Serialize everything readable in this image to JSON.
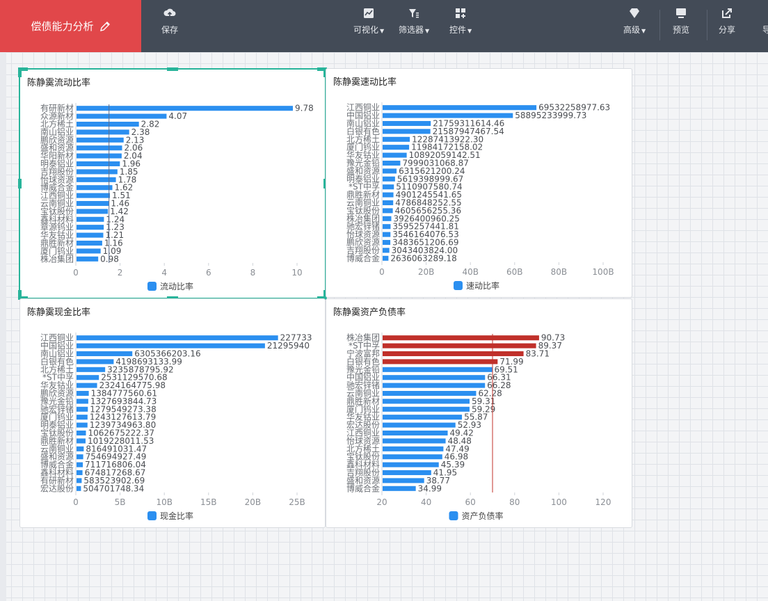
{
  "app": {
    "title": "偿债能力分析"
  },
  "toolbar": {
    "save": "保存",
    "visualize": "可视化",
    "filter": "筛选器",
    "widget": "控件",
    "advanced": "高级",
    "preview": "预览",
    "share": "分享",
    "export": "导"
  },
  "charts": [
    {
      "title": "陈静霙流动比率",
      "legend": "流动比率",
      "color": "#2b8ff0",
      "chart_data": {
        "type": "bar",
        "orientation": "horizontal",
        "categories": [
          "有研新材",
          "众源新材",
          "北方稀土",
          "南山铝业",
          "鹏欣资源",
          "盛和资源",
          "华阳新材",
          "明泰铝业",
          "吉翔股份",
          "怡球资源",
          "博威合金",
          "江西铜业",
          "云南铜业",
          "宝钛股份",
          "鑫科材料",
          "章源钨业",
          "华友钴业",
          "鼎胜新材",
          "厦门钨业",
          "株冶集团"
        ],
        "values": [
          9.78,
          4.07,
          2.82,
          2.38,
          2.13,
          2.06,
          2.04,
          1.96,
          1.85,
          1.78,
          1.62,
          1.51,
          1.46,
          1.42,
          1.24,
          1.23,
          1.21,
          1.16,
          1.09,
          0.98
        ],
        "labels": [
          "9.78",
          "4.07",
          "2.82",
          "2.38",
          "2.13",
          "2.06",
          "2.04",
          "1.96",
          "1.85",
          "1.78",
          "1.62",
          "1.51",
          "1.46",
          "1.42",
          "1.24",
          "1.23",
          "1.21",
          "1.16",
          "1.09",
          "0.98"
        ],
        "xlim": [
          0,
          10
        ],
        "ticks": [
          0,
          2,
          4,
          6,
          8,
          10
        ],
        "tick_labels": [
          "0",
          "2",
          "4",
          "6",
          "8",
          "10"
        ],
        "reference_line": 1.5
      }
    },
    {
      "title": "陈静霙速动比率",
      "legend": "速动比率",
      "color": "#2b8ff0",
      "chart_data": {
        "type": "bar",
        "orientation": "horizontal",
        "categories": [
          "江西铜业",
          "中国铝业",
          "南山铝业",
          "白银有色",
          "北方稀土",
          "厦门钨业",
          "华友钴业",
          "豫光金铅",
          "盛和资源",
          "明泰铝业",
          "*ST中孚",
          "鼎胜新材",
          "云南铜业",
          "宝钛股份",
          "株冶集团",
          "驰宏锌锗",
          "怡球资源",
          "鹏欣资源",
          "吉翔股份",
          "博威合金"
        ],
        "values": [
          69532258977.63,
          58895233999.73,
          21759311614.46,
          21587947467.54,
          12287413922.3,
          11984172158.02,
          10892059142.51,
          7999031068.87,
          6315621200.24,
          5619398999.67,
          5110907580.74,
          4901245541.65,
          4786848252.55,
          4605656255.36,
          3926400960.25,
          3595257441.81,
          3546164076.53,
          3483651206.69,
          3043403824.0,
          2636063289.18
        ],
        "labels": [
          "69532258977.63",
          "58895233999.73",
          "21759311614.46",
          "21587947467.54",
          "12287413922.30",
          "11984172158.02",
          "10892059142.51",
          "7999031068.87",
          "6315621200.24",
          "5619398999.67",
          "5110907580.74",
          "4901245541.65",
          "4786848252.55",
          "4605656255.36",
          "3926400960.25",
          "3595257441.81",
          "3546164076.53",
          "3483651206.69",
          "3043403824.00",
          "2636063289.18"
        ],
        "xlim": [
          0,
          100000000000
        ],
        "ticks": [
          0,
          20000000000,
          40000000000,
          60000000000,
          80000000000,
          100000000000
        ],
        "tick_labels": [
          "0",
          "20B",
          "40B",
          "60B",
          "80B",
          "100B"
        ]
      }
    },
    {
      "title": "陈静霙现金比率",
      "legend": "现金比率",
      "color": "#2b8ff0",
      "chart_data": {
        "type": "bar",
        "orientation": "horizontal",
        "categories": [
          "江西铜业",
          "中国铝业",
          "南山铝业",
          "白银有色",
          "北方稀土",
          "*ST中孚",
          "华友钴业",
          "鹏欣资源",
          "豫光金铅",
          "驰宏锌锗",
          "厦门钨业",
          "明泰铝业",
          "宝钛股份",
          "鼎胜新材",
          "云南铜业",
          "盛和资源",
          "博威合金",
          "鑫科材料",
          "有研新材",
          "宏达股份"
        ],
        "values": [
          22773300000,
          21295940000,
          6305366203.16,
          4198693133.99,
          3235878795.92,
          2531129570.68,
          2324164775.98,
          1384777560.61,
          1327693844.73,
          1279549273.38,
          1243127613.79,
          1239734963.8,
          1062675222.37,
          1019228011.53,
          816491031.47,
          754694927.49,
          711716806.04,
          674817268.67,
          583523902.69,
          504701748.34
        ],
        "labels": [
          "227733",
          "21295940",
          "6305366203.16",
          "4198693133.99",
          "3235878795.92",
          "2531129570.68",
          "2324164775.98",
          "1384777560.61",
          "1327693844.73",
          "1279549273.38",
          "1243127613.79",
          "1239734963.80",
          "1062675222.37",
          "1019228011.53",
          "816491031.47",
          "754694927.49",
          "711716806.04",
          "674817268.67",
          "583523902.69",
          "504701748.34"
        ],
        "xlim": [
          0,
          25000000000
        ],
        "ticks": [
          0,
          5000000000,
          10000000000,
          15000000000,
          20000000000,
          25000000000
        ],
        "tick_labels": [
          "0",
          "5B",
          "10B",
          "15B",
          "20B",
          "25B"
        ]
      }
    },
    {
      "title": "陈静霙资产负债率",
      "legend": "资产负债率",
      "color": "#2b8ff0",
      "highlight_color": "#c0302a",
      "chart_data": {
        "type": "bar",
        "orientation": "horizontal",
        "categories": [
          "株冶集团",
          "*ST中孚",
          "宁波富邦",
          "白银有色",
          "豫光金铅",
          "中国铝业",
          "驰宏锌锗",
          "云南铜业",
          "鼎胜新材",
          "厦门钨业",
          "华友钴业",
          "宏达股份",
          "江西铜业",
          "怡球资源",
          "北方稀土",
          "宝钛股份",
          "鑫科材料",
          "吉翔股份",
          "盛和资源",
          "博威合金"
        ],
        "values": [
          90.73,
          89.37,
          83.71,
          71.99,
          69.51,
          66.31,
          66.28,
          62.28,
          59.31,
          59.29,
          55.87,
          52.93,
          49.42,
          48.48,
          47.49,
          46.98,
          45.39,
          41.95,
          38.77,
          34.99
        ],
        "labels": [
          "90.73",
          "89.37",
          "83.71",
          "71.99",
          "69.51",
          "66.31",
          "66.28",
          "62.28",
          "59.31",
          "59.29",
          "55.87",
          "52.93",
          "49.42",
          "48.48",
          "47.49",
          "46.98",
          "45.39",
          "41.95",
          "38.77",
          "34.99"
        ],
        "highlight_above": 70,
        "xlim": [
          20,
          120
        ],
        "ticks": [
          20,
          40,
          60,
          80,
          100,
          120
        ],
        "tick_labels": [
          "20",
          "40",
          "60",
          "80",
          "100",
          "120"
        ],
        "reference_line": 70
      }
    }
  ]
}
